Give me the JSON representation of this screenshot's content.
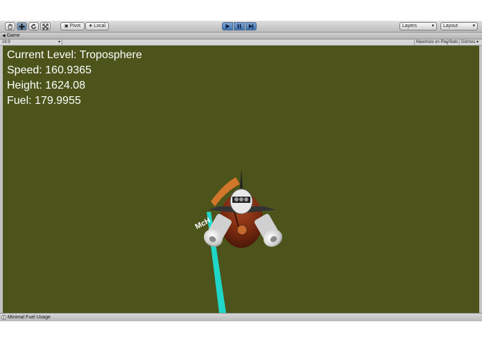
{
  "toolbar": {
    "pivot_label": "Pivot",
    "local_label": "Local",
    "layers_label": "Layers",
    "layout_label": "Layout",
    "tools": [
      "hand-icon",
      "move-icon",
      "rotate-icon",
      "scale-icon"
    ]
  },
  "tabs": {
    "game_label": "Game"
  },
  "game_bar": {
    "aspect_label": "16:9",
    "maximize_label": "Maximize on Play",
    "stats_label": "Stats",
    "gizmos_label": "Gizmos"
  },
  "hud": {
    "level": "Current Level: Troposphere",
    "speed": "Speed: 160.9365",
    "height": "Height: 1624.08",
    "fuel": "Fuel: 179.9955"
  },
  "scene": {
    "ship_label": "McH",
    "background_color": "#4c541b",
    "trail_color": "#1fd7c9"
  },
  "status": {
    "text": "Minimal Fuel Usage"
  }
}
